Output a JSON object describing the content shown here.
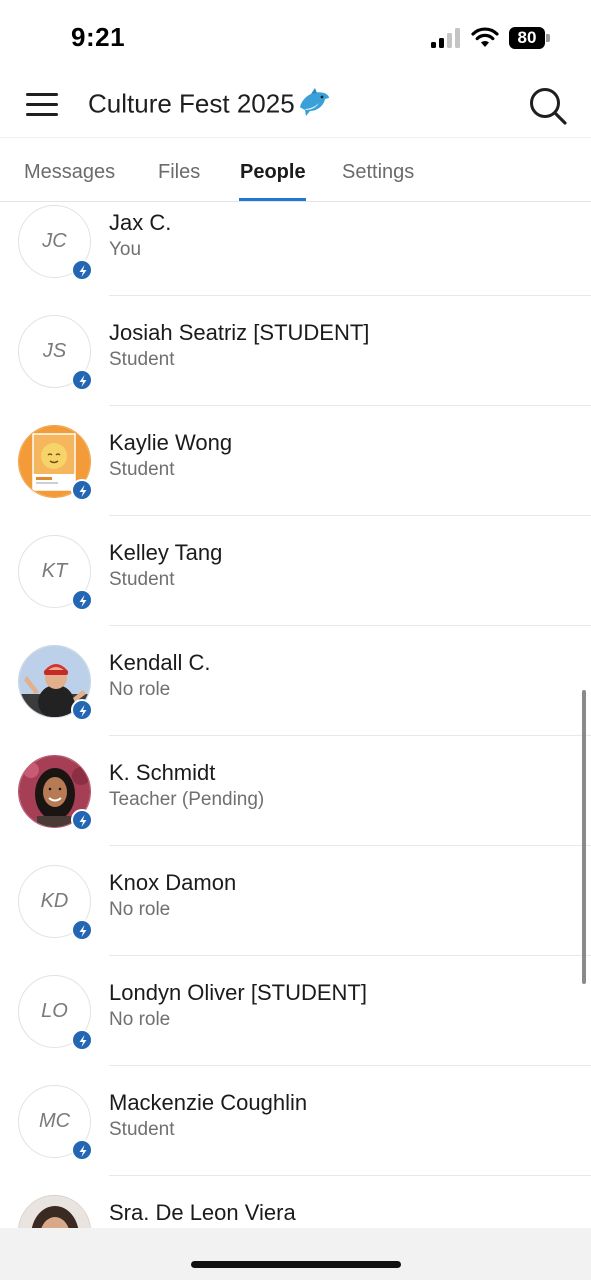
{
  "status_bar": {
    "time": "9:21",
    "battery": "80",
    "icons": [
      "cellular-signal-icon",
      "wifi-icon",
      "battery-icon"
    ]
  },
  "header": {
    "title": "Culture Fest 2025",
    "title_emoji": "dolphin-icon",
    "menu_icon": "hamburger-menu-icon",
    "search_icon": "search-icon"
  },
  "tabs": [
    {
      "label": "Messages",
      "active": false
    },
    {
      "label": "Files",
      "active": false
    },
    {
      "label": "People",
      "active": true
    },
    {
      "label": "Settings",
      "active": false
    }
  ],
  "people": [
    {
      "name": "Jax C.",
      "role": "You",
      "initials": "JC",
      "avatar": "initials"
    },
    {
      "name": "Josiah Seatriz [STUDENT]",
      "role": "Student",
      "initials": "JS",
      "avatar": "initials"
    },
    {
      "name": "Kaylie Wong",
      "role": "Student",
      "initials": "",
      "avatar": "photo-orange-illustration"
    },
    {
      "name": "Kelley Tang",
      "role": "Student",
      "initials": "KT",
      "avatar": "initials"
    },
    {
      "name": "Kendall C.",
      "role": "No role",
      "initials": "",
      "avatar": "photo-person-red-cap"
    },
    {
      "name": "K. Schmidt",
      "role": "Teacher (Pending)",
      "initials": "",
      "avatar": "photo-person-smiling"
    },
    {
      "name": "Knox Damon",
      "role": "No role",
      "initials": "KD",
      "avatar": "initials"
    },
    {
      "name": "Londyn Oliver [STUDENT]",
      "role": "No role",
      "initials": "LO",
      "avatar": "initials"
    },
    {
      "name": "Mackenzie Coughlin",
      "role": "Student",
      "initials": "MC",
      "avatar": "initials"
    },
    {
      "name": "Sra. De Leon Viera",
      "role": "",
      "initials": "",
      "avatar": "photo-person-glasses"
    }
  ],
  "badge_icon": "lightning-bolt-icon",
  "colors": {
    "accent": "#1f78d1",
    "badge": "#2366b4"
  }
}
